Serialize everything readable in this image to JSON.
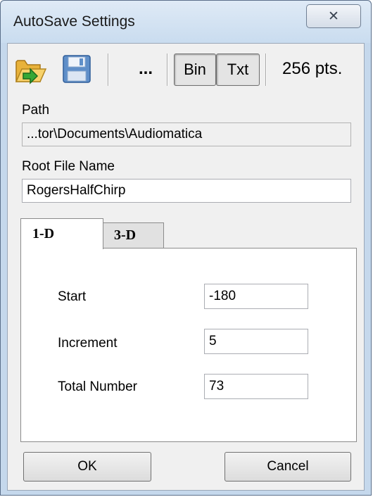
{
  "window": {
    "title": "AutoSave Settings",
    "close_glyph": "✕"
  },
  "toolbar": {
    "open_icon": "folder-open-icon",
    "save_icon": "floppy-disk-icon",
    "browse_label": "...",
    "bin_label": "Bin",
    "txt_label": "Txt",
    "points_text": "256 pts."
  },
  "path": {
    "label": "Path",
    "value": "...tor\\Documents\\Audiomatica"
  },
  "root_file": {
    "label": "Root File Name",
    "value": "RogersHalfChirp"
  },
  "tabs": [
    {
      "label": "1-D"
    },
    {
      "label": "3-D"
    }
  ],
  "params": {
    "start": {
      "label": "Start",
      "value": "-180"
    },
    "increment": {
      "label": "Increment",
      "value": "5"
    },
    "total": {
      "label": "Total Number",
      "value": "73"
    }
  },
  "buttons": {
    "ok_label": "OK",
    "cancel_label": "Cancel"
  },
  "colors": {
    "title_bar": "#c9dcef",
    "dialog_bg": "#f0f0f0",
    "accent_green": "#2e9e2e"
  }
}
